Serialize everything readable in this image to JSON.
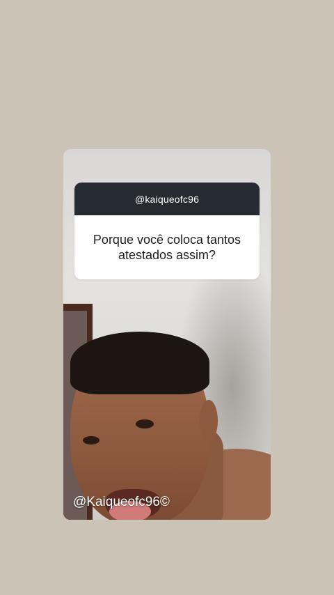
{
  "story": {
    "question_sticker": {
      "username": "@kaiqueofc96",
      "question": "Porque você coloca tantos atestados assim?"
    },
    "watermark": "@Kaiqueofc96©"
  },
  "colors": {
    "background": "#cbc3b5",
    "sticker_header": "#262a31",
    "sticker_body": "#ffffff"
  }
}
